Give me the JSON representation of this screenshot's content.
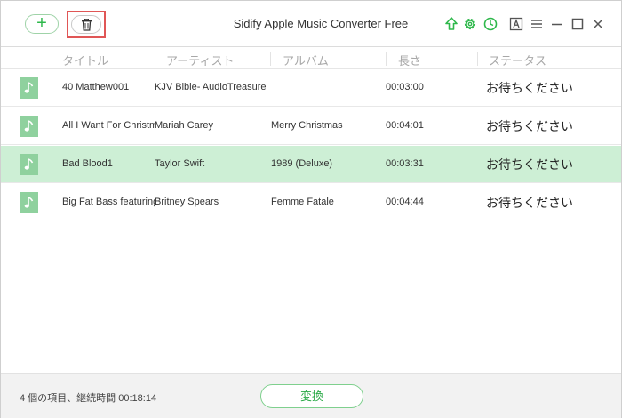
{
  "app": {
    "title": "Sidify Apple Music Converter Free",
    "accent_color": "#2eb84b",
    "selected_row_color": "#cdefd5",
    "highlight_border_color": "#e05656"
  },
  "toolbar": {
    "add_label": "+",
    "icons": [
      "upload-icon",
      "gear-icon",
      "clock-icon",
      "font-icon",
      "menu-icon",
      "minimize-icon",
      "maximize-icon",
      "close-icon"
    ]
  },
  "columns": [
    "タイトル",
    "アーティスト",
    "アルバム",
    "長さ",
    "ステータス"
  ],
  "rows": [
    {
      "title": "40 Matthew001",
      "artist": "KJV Bible- AudioTreasure",
      "album": "",
      "duration": "00:03:00",
      "status": "お待ちください"
    },
    {
      "title": "All I Want For Christmas Is You",
      "artist": "Mariah Carey",
      "album": "Merry Christmas",
      "duration": "00:04:01",
      "status": "お待ちください"
    },
    {
      "title": "Bad Blood1",
      "artist": "Taylor Swift",
      "album": "1989 (Deluxe)",
      "duration": "00:03:31",
      "status": "お待ちください"
    },
    {
      "title": "Big Fat Bass featuring will.i.am",
      "artist": "Britney Spears",
      "album": "Femme Fatale",
      "duration": "00:04:44",
      "status": "お待ちください"
    }
  ],
  "selected_row": 2,
  "footer": {
    "summary_prefix": "4 個の項目、継続時間",
    "summary_duration": "00:18:14",
    "convert_label": "変換"
  }
}
